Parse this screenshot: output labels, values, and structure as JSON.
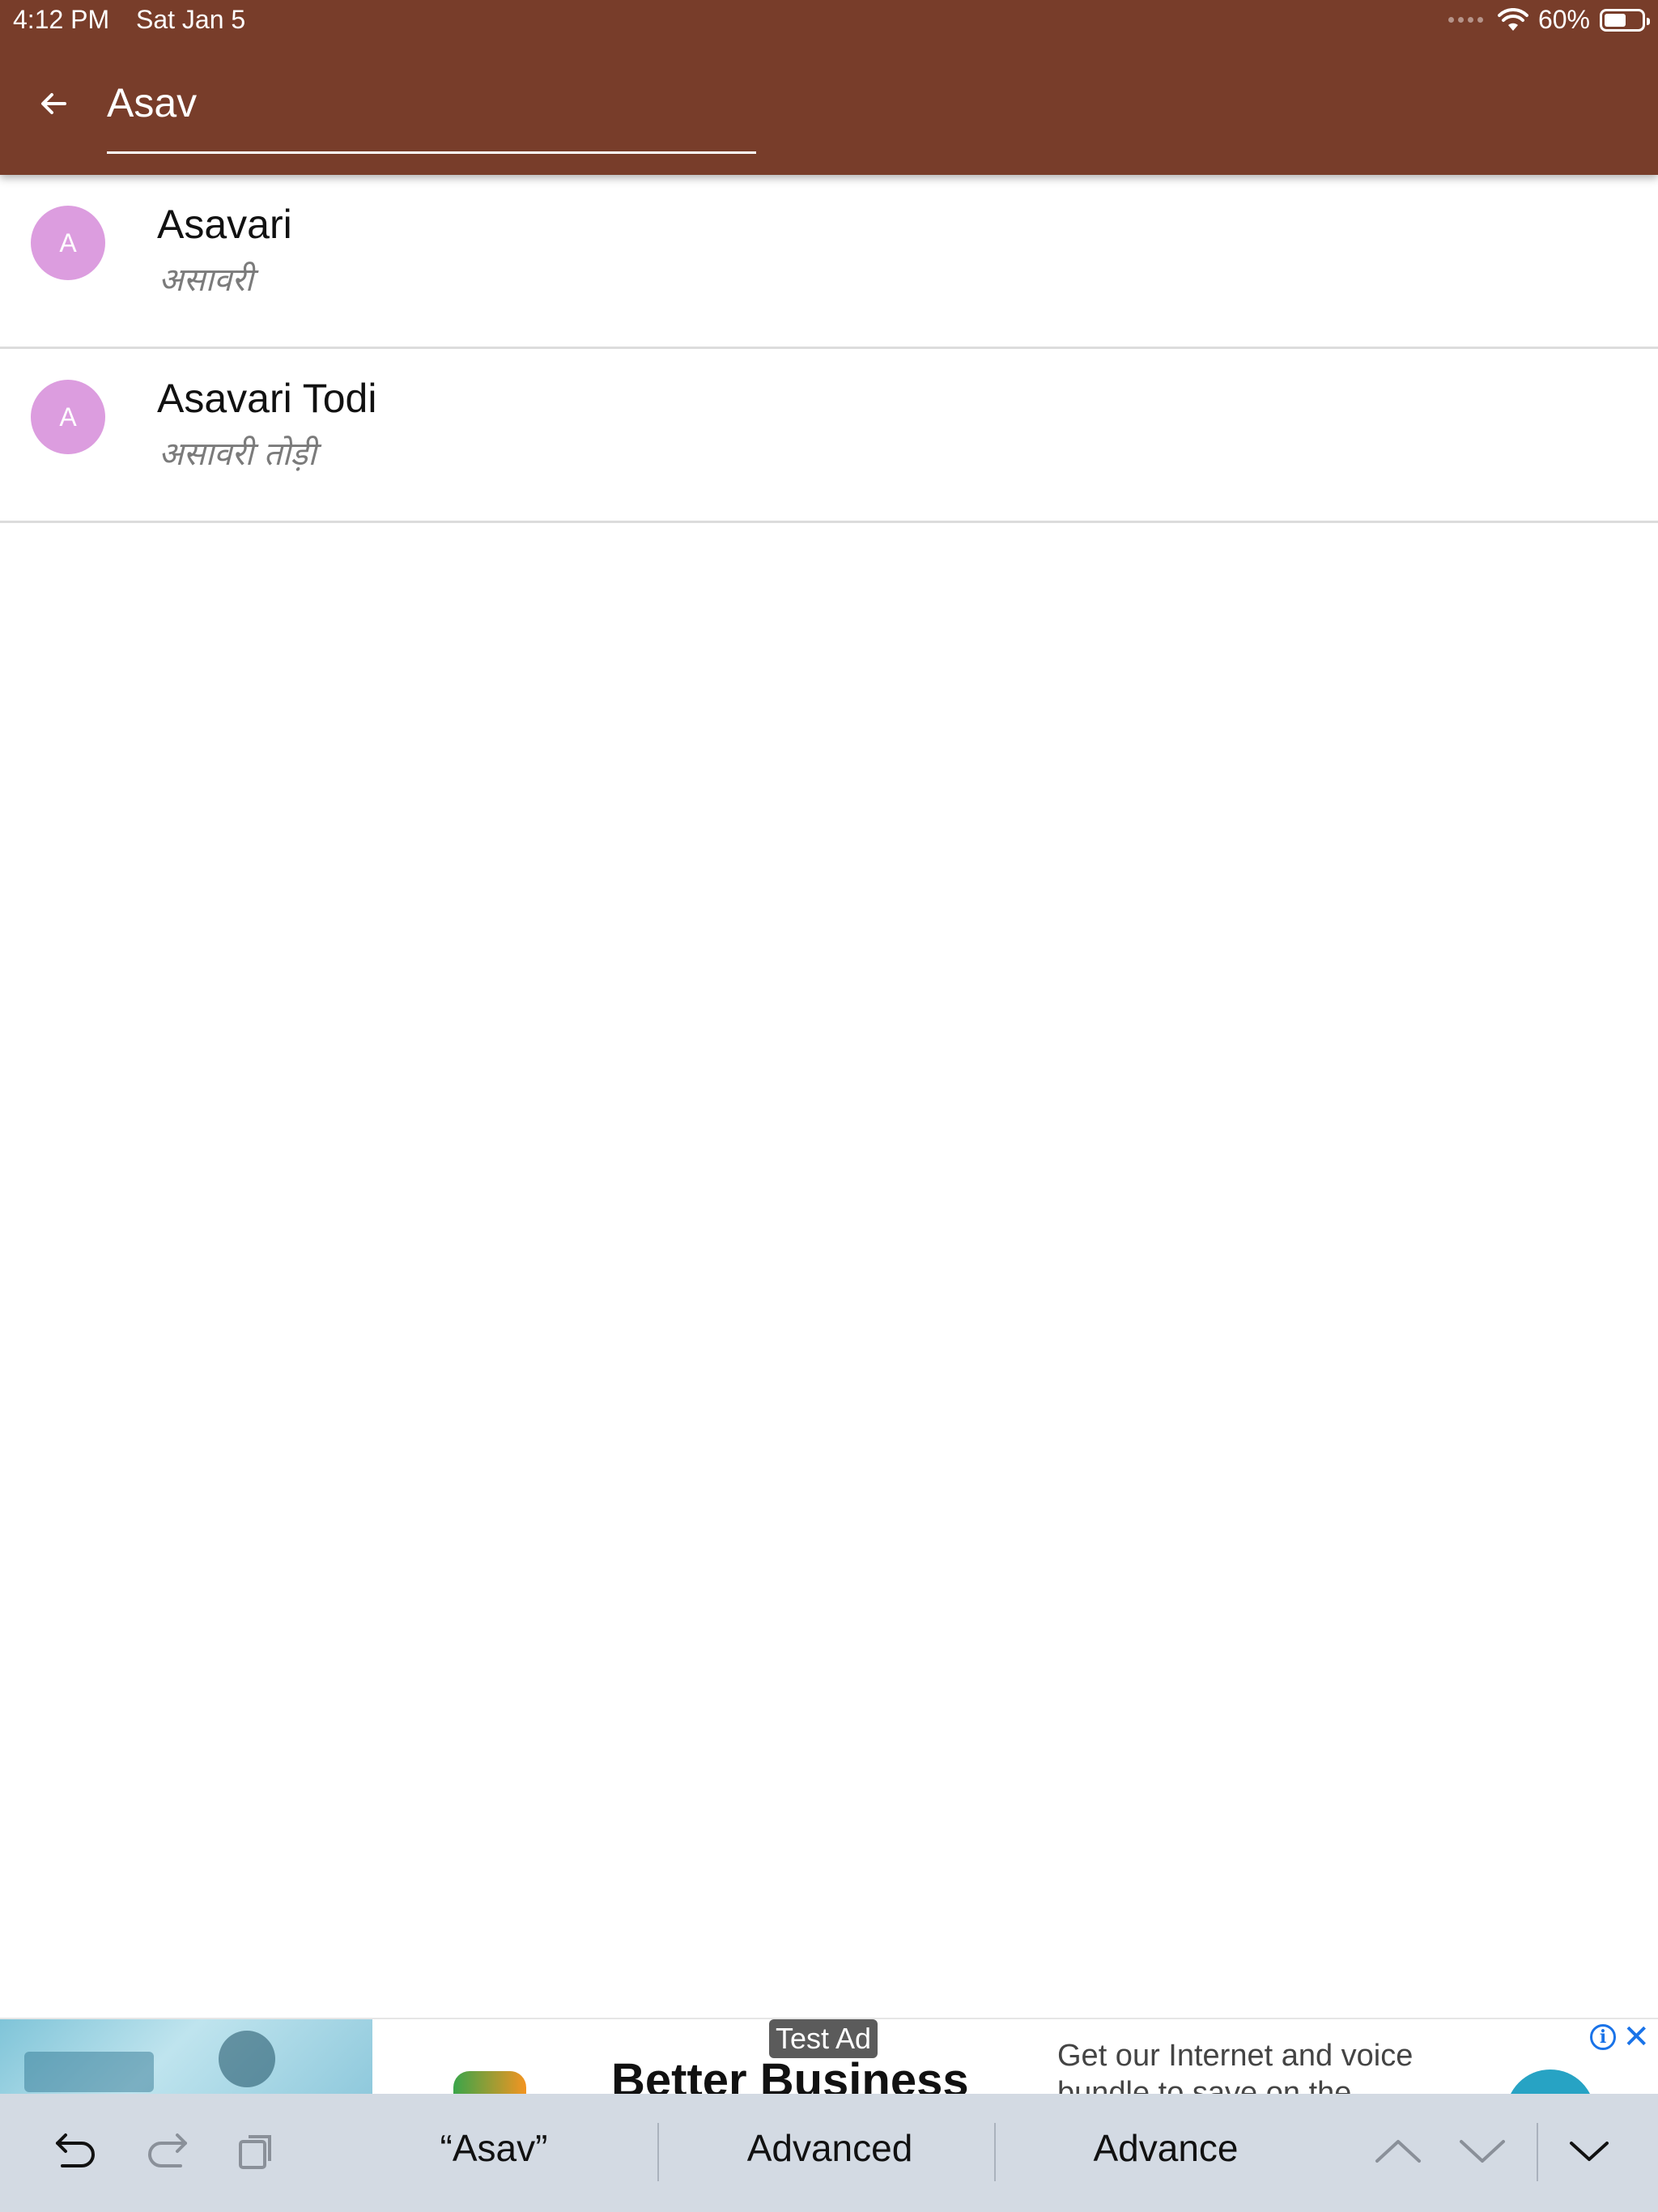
{
  "status_bar": {
    "time": "4:12 PM",
    "date": "Sat Jan 5",
    "battery": "60%",
    "battery_level": 0.6
  },
  "search": {
    "query": "Asav",
    "back_icon": "arrow-left-icon"
  },
  "results": [
    {
      "avatar_letter": "A",
      "title": "Asavari",
      "subtitle": "असावरी"
    },
    {
      "avatar_letter": "A",
      "title": "Asavari Todi",
      "subtitle": "असावरी तोड़ी"
    }
  ],
  "ad": {
    "label": "Test Ad",
    "headline": "Better Business",
    "body": "Get our Internet and voice bundle to save on the"
  },
  "keyboard_bar": {
    "suggestions": [
      "“Asav”",
      "Advanced",
      "Advance"
    ],
    "icons": [
      "undo-icon",
      "redo-icon",
      "paste-icon",
      "chevron-up-icon",
      "chevron-down-icon",
      "dismiss-keyboard-icon"
    ]
  },
  "colors": {
    "appbar": "#783d2a",
    "avatar": "#dc9ddf",
    "keyboard_bar": "#d3dae3"
  }
}
